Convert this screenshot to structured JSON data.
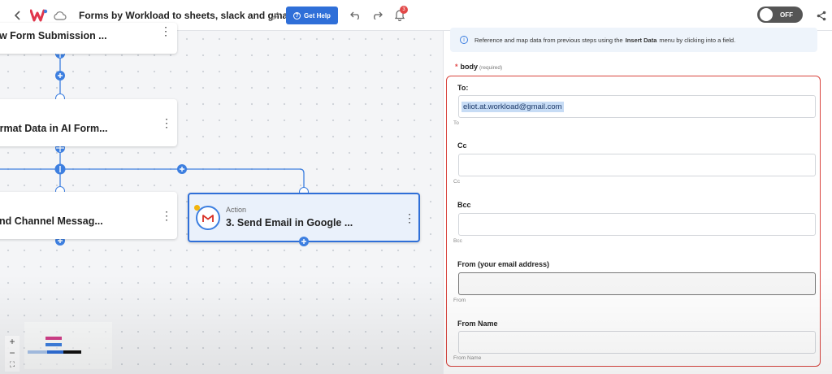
{
  "header": {
    "workflow_title": "Forms by Workload to sheets, slack and gmail",
    "get_help_label": "Get Help",
    "get_help_icon": "?",
    "notification_count": "3",
    "toggle_label": "OFF"
  },
  "canvas": {
    "nodes": [
      {
        "title": "ew Form Submission ..."
      },
      {
        "title": "ormat Data in AI Form..."
      },
      {
        "title": "end Channel Messag..."
      },
      {
        "type_label": "Action",
        "title": "3. Send Email in Google ...",
        "app": "M"
      }
    ],
    "zoom_in": "+",
    "zoom_out": "−",
    "fit": "⛶"
  },
  "panel": {
    "info": {
      "text_before": "Reference and map data from previous steps using the",
      "bold": "Insert Data",
      "text_after": "menu by clicking into a field."
    },
    "body_label": "body",
    "required_label": "(required)",
    "fields": [
      {
        "label": "To:",
        "value": "eliot.at.workload@gmail.com",
        "hint": "To"
      },
      {
        "label": "Cc",
        "value": "",
        "hint": "Cc"
      },
      {
        "label": "Bcc",
        "value": "",
        "hint": "Bcc"
      },
      {
        "label": "From (your email address)",
        "value": "",
        "hint": "From"
      },
      {
        "label": "From Name",
        "value": "",
        "hint": "From Name"
      }
    ]
  },
  "colors": {
    "accent_blue": "#2f6fd8",
    "error_red": "#d9443e",
    "badge_red": "#e24848"
  }
}
